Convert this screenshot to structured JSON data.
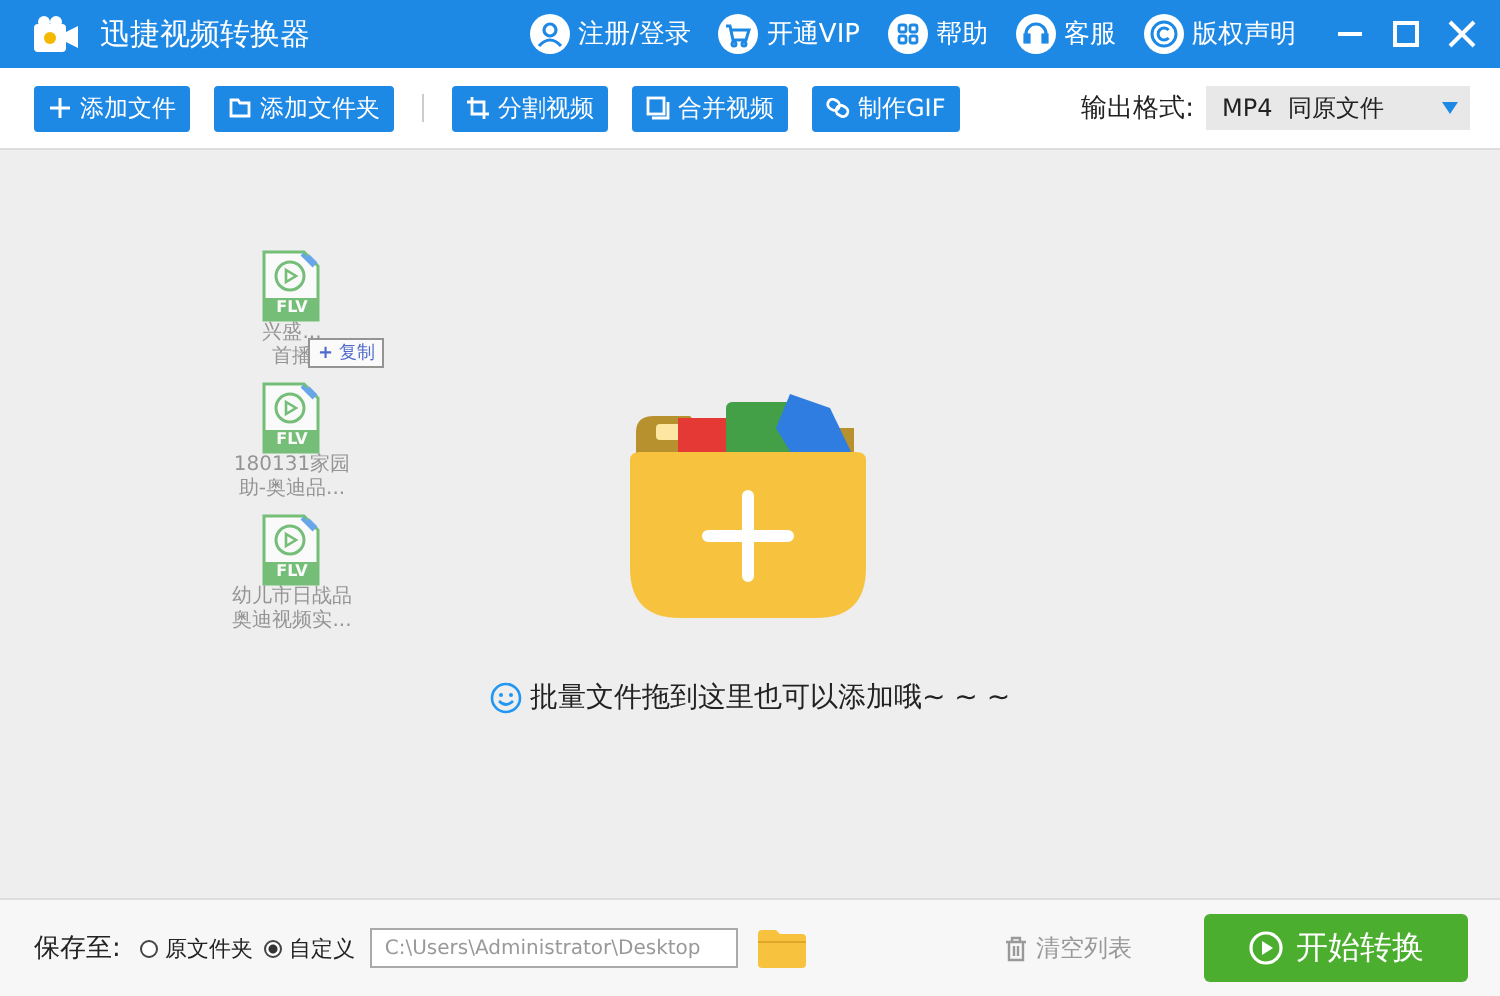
{
  "window": {
    "title": "迅捷视频转换器"
  },
  "header_links": [
    {
      "kind": "user",
      "label": "注册/登录"
    },
    {
      "kind": "cart",
      "label": "开通VIP"
    },
    {
      "kind": "grid",
      "label": "帮助"
    },
    {
      "kind": "headset",
      "label": "客服"
    },
    {
      "kind": "copyright",
      "label": "版权声明"
    }
  ],
  "toolbar": [
    {
      "kind": "plus",
      "label": "添加文件"
    },
    {
      "kind": "folder",
      "label": "添加文件夹"
    },
    {
      "kind": "crop",
      "label": "分割视频"
    },
    {
      "kind": "merge",
      "label": "合并视频"
    },
    {
      "kind": "gif",
      "label": "制作GIF"
    }
  ],
  "output_format": {
    "label": "输出格式:",
    "value": "MP4  同原文件"
  },
  "dragged_files": [
    {
      "type": "FLV",
      "lines": [
        "兴盛...",
        "首播"
      ]
    },
    {
      "type": "FLV",
      "lines": [
        "180131家园",
        "助-奥迪品..."
      ]
    },
    {
      "type": "FLV",
      "lines": [
        "幼儿市日战品",
        "奥迪视频实..."
      ]
    }
  ],
  "drag_tooltip": {
    "symbol": "+",
    "label": "复制"
  },
  "drop_hint": "批量文件拖到这里也可以添加哦~ ~ ~",
  "footer": {
    "save_label": "保存至:",
    "options": [
      {
        "label": "原文件夹",
        "selected": false
      },
      {
        "label": "自定义",
        "selected": true
      }
    ],
    "path": "C:\\Users\\Administrator\\Desktop",
    "clear": "清空列表",
    "start": "开始转换"
  }
}
